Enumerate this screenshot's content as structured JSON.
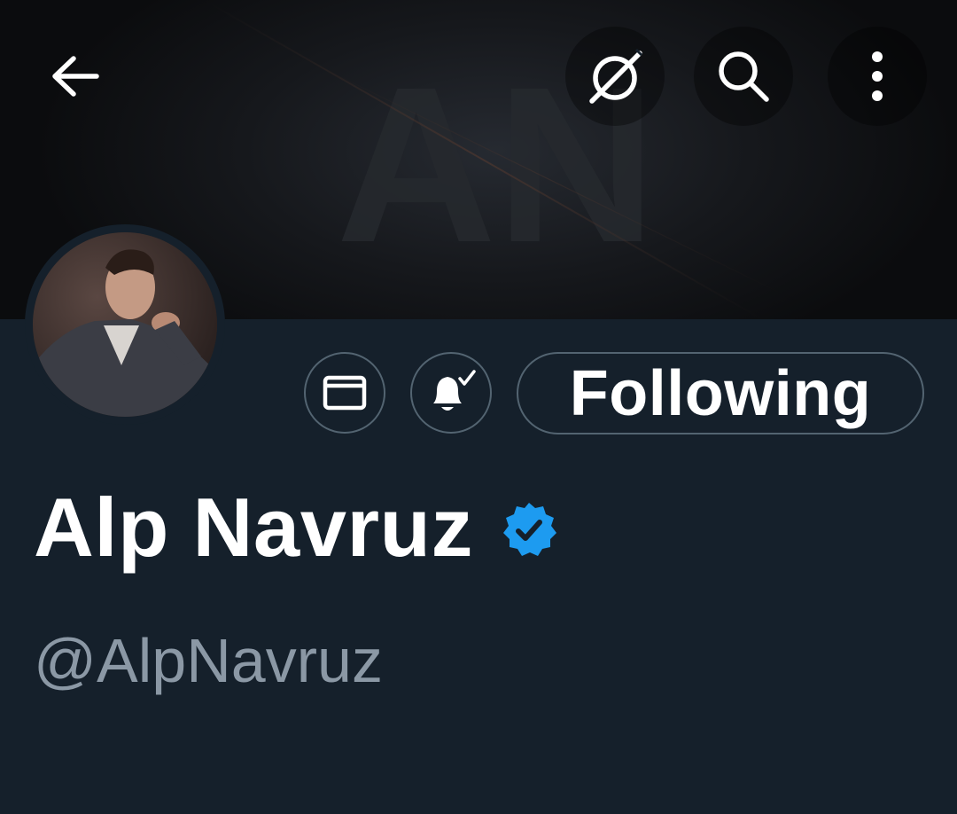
{
  "banner": {
    "watermark_text": "AN",
    "background_color": "#0b0c0e"
  },
  "topbar": {
    "back_icon": "back-arrow-icon",
    "grok_icon": "grok-icon",
    "search_icon": "search-icon",
    "more_icon": "more-vertical-icon"
  },
  "profile": {
    "display_name": "Alp Navruz",
    "handle": "@AlpNavruz",
    "verified": true,
    "verified_color": "#1d9bf0"
  },
  "actions": {
    "message_icon": "envelope-icon",
    "notifications_icon": "bell-subscribed-icon",
    "follow_label": "Following"
  },
  "colors": {
    "background": "#15202b",
    "border": "#536471",
    "secondary_text": "#8b98a5",
    "primary_text": "#ffffff"
  }
}
